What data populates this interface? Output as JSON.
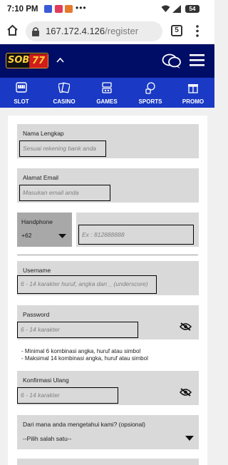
{
  "status_bar": {
    "time": "7:10 PM",
    "more": "•••",
    "battery": "54"
  },
  "browser": {
    "url_host": "167.172.4.126",
    "url_path": "/register",
    "tab_count": "5"
  },
  "header": {
    "logo_sob": "SOB",
    "logo_num": "77"
  },
  "nav": [
    {
      "label": "SLOT",
      "icon": "slot-machine-icon"
    },
    {
      "label": "CASINO",
      "icon": "cards-icon"
    },
    {
      "label": "GAMES",
      "icon": "games-icon"
    },
    {
      "label": "SPORTS",
      "icon": "sports-icon"
    },
    {
      "label": "PROMO",
      "icon": "promo-icon"
    }
  ],
  "form": {
    "nama": {
      "label": "Nama Lengkap",
      "placeholder": "Sesuai rekening bank anda"
    },
    "email": {
      "label": "Alamat Email",
      "placeholder": "Masukan email anda"
    },
    "phone": {
      "label": "Handphone",
      "code": "+62",
      "placeholder": "Ex : 812888888"
    },
    "username": {
      "label": "Username",
      "placeholder": "6 - 14 karakter huruf, angka dan _ (underscore)"
    },
    "password": {
      "label": "Password",
      "placeholder": "6 - 14 karakter"
    },
    "rules": [
      "- Minimal 6 kombinasi angka, huruf atau simbol",
      "- Maksimal 14 kombinasi angka, huruf atau simbol"
    ],
    "confirm": {
      "label": "Konfirmasi Ulang",
      "placeholder": "6 - 14 karakter"
    },
    "source": {
      "label": "Dari mana anda mengetahui kami? (opsional)",
      "selected": "--Pilih salah satu--"
    }
  },
  "colors": {
    "header_bg": "#000d66",
    "nav_bg": "#1a39c4",
    "field_bg": "#d9d9d9",
    "logo_gold": "#ffd23a",
    "logo_red": "#d01c1c"
  }
}
